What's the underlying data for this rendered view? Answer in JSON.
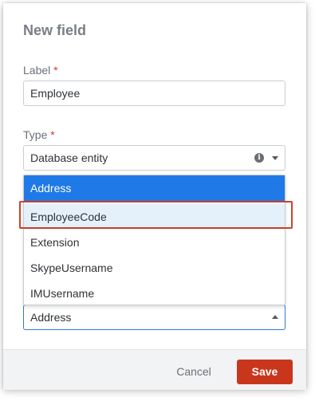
{
  "dialog": {
    "title": "New field"
  },
  "label_field": {
    "label": "Label",
    "required_mark": "*",
    "value": "Employee"
  },
  "type_field": {
    "label": "Type",
    "required_mark": "*",
    "value": "Database entity",
    "info_icon": "info-icon"
  },
  "dropdown": {
    "options": [
      {
        "label": "Address",
        "state": "selected"
      },
      {
        "label": "EmployeeCode",
        "state": "hovered"
      },
      {
        "label": "Extension",
        "state": "normal"
      },
      {
        "label": "SkypeUsername",
        "state": "normal"
      },
      {
        "label": "IMUsername",
        "state": "normal"
      }
    ]
  },
  "field_select": {
    "value": "Address"
  },
  "footer": {
    "cancel_label": "Cancel",
    "save_label": "Save"
  },
  "colors": {
    "accent": "#1f7ae8",
    "hover": "#e4f1fb",
    "primary_button": "#c8371c",
    "highlight_border": "#c8442b"
  }
}
